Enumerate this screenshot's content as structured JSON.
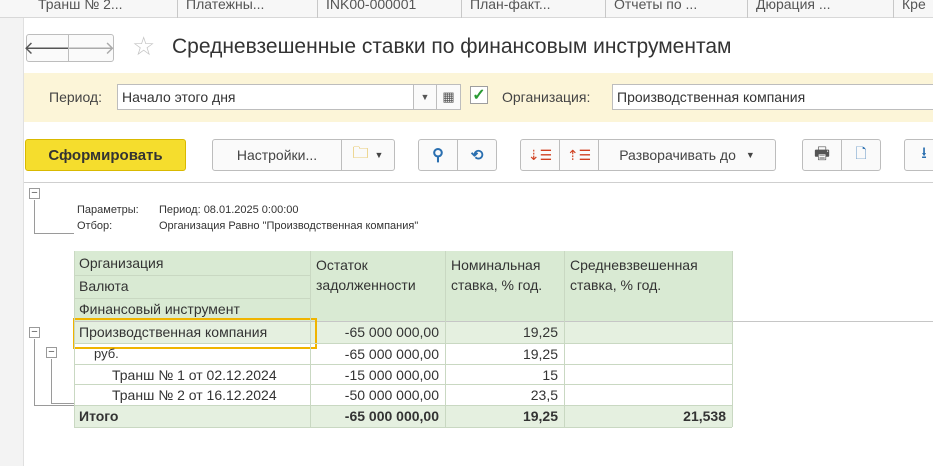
{
  "tabs": [
    {
      "label": "Транш № 2..."
    },
    {
      "label": "Платежны..."
    },
    {
      "label": "INK00-000001"
    },
    {
      "label": "План-факт..."
    },
    {
      "label": "Отчеты по ..."
    },
    {
      "label": "Дюрация ..."
    },
    {
      "label": "Кре"
    }
  ],
  "header": {
    "title": "Средневзешенные ставки по финансовым инструментам",
    "back_icon": "arrow-left-icon",
    "forward_icon": "arrow-right-icon",
    "favorite_icon": "star-icon"
  },
  "filters": {
    "period_label": "Период:",
    "period_value": "Начало этого дня",
    "org_label": "Организация:",
    "org_checked": true,
    "org_value": "Производственная компания"
  },
  "toolbar": {
    "generate_label": "Сформировать",
    "settings_label": "Настройки...",
    "expand_label": "Разворачивать до"
  },
  "report": {
    "params_label": "Параметры:",
    "params_value": "Период: 08.01.2025 0:00:00",
    "filter_label": "Отбор:",
    "filter_value": "Организация Равно \"Производственная компания\"",
    "headers": {
      "grouping": [
        "Организация",
        "Валюта",
        "Финансовый инструмент"
      ],
      "debt": "Остаток задолженности",
      "nominal": "Номинальная ставка, % год.",
      "weighted": "Средневзвешенная ставка, % год."
    },
    "rows": [
      {
        "name": "Производственная компания",
        "debt": "-65 000 000,00",
        "nominal": "19,25",
        "weighted": ""
      },
      {
        "name": "руб.",
        "debt": "-65 000 000,00",
        "nominal": "19,25",
        "weighted": ""
      },
      {
        "name": "Транш № 1 от 02.12.2024",
        "debt": "-15 000 000,00",
        "nominal": "15",
        "weighted": ""
      },
      {
        "name": "Транш № 2 от 16.12.2024",
        "debt": "-50 000 000,00",
        "nominal": "23,5",
        "weighted": ""
      }
    ],
    "total": {
      "name": "Итого",
      "debt": "-65 000 000,00",
      "nominal": "19,25",
      "weighted": "21,538"
    }
  },
  "colors": {
    "accent": "#f5dd2d",
    "filter_bg": "#fcf5d8",
    "table_header": "#d9ead3",
    "selection": "#f0b400"
  }
}
